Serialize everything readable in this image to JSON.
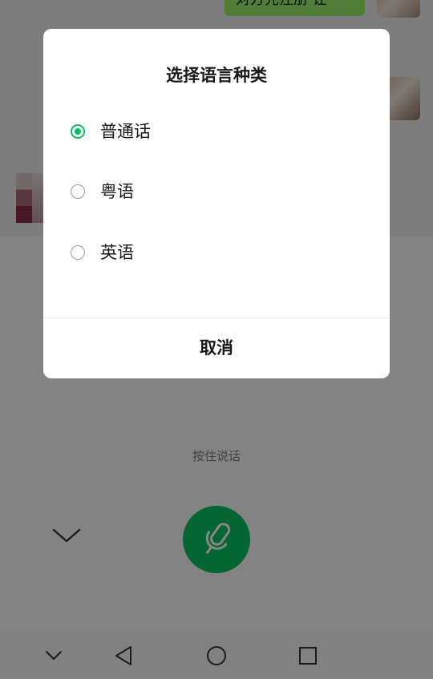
{
  "chat": {
    "sent_message": "对方先注册 让"
  },
  "voice_panel": {
    "hold_to_talk": "按住说话"
  },
  "dialog": {
    "title": "选择语言种类",
    "options": [
      {
        "label": "普通话",
        "selected": true
      },
      {
        "label": "粤语",
        "selected": false
      },
      {
        "label": "英语",
        "selected": false
      }
    ],
    "cancel": "取消"
  },
  "colors": {
    "accent": "#07c160",
    "bubble": "#95ec69",
    "overlay": "rgba(0,0,0,0.47)"
  },
  "icons": {
    "collapse": "chevron-down-icon",
    "mic": "microphone-icon",
    "nav": [
      "chevron-down-icon",
      "back-triangle-icon",
      "home-circle-icon",
      "recents-square-icon"
    ]
  }
}
